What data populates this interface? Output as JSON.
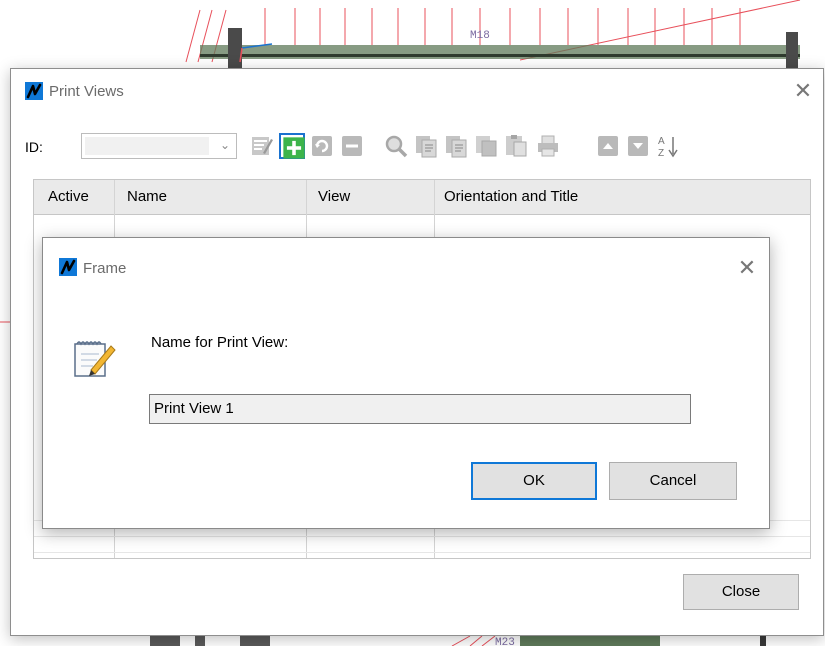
{
  "background": {
    "member_label_top": "M18",
    "member_label_bottom": "M23"
  },
  "print_views_dialog": {
    "title": "Print Views",
    "close_glyph": "✕",
    "id_label": "ID:",
    "id_value": "",
    "columns": [
      "Active",
      "Name",
      "View",
      "Orientation and Title"
    ],
    "close_button": "Close",
    "toolbar_icons": [
      "edit-icon",
      "add-icon",
      "refresh-icon",
      "delete-icon",
      "zoom-icon",
      "copy-icon",
      "copy-alt-icon",
      "paste-icon",
      "paste-alt-icon",
      "print-icon",
      "move-up-icon",
      "move-down-icon",
      "sort-az-icon"
    ]
  },
  "frame_dialog": {
    "title": "Frame",
    "close_glyph": "✕",
    "prompt": "Name for Print View:",
    "name_value": "Print View 1",
    "ok_button": "OK",
    "cancel_button": "Cancel"
  },
  "colors": {
    "accent": "#0f78d7",
    "add_green": "#3cb44b",
    "model_red": "#e8505b",
    "model_green": "#5f7a5a"
  }
}
